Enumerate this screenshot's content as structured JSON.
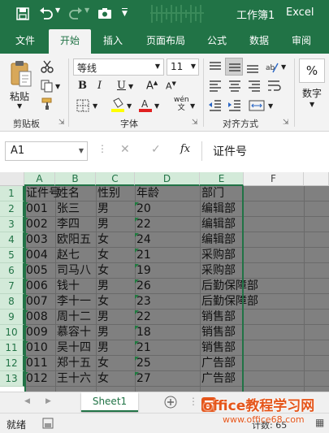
{
  "title_bar": {
    "doc_name": "工作簿1",
    "app_name": "Excel"
  },
  "tabs": [
    {
      "label": "文件",
      "active": false
    },
    {
      "label": "开始",
      "active": true
    },
    {
      "label": "插入",
      "active": false
    },
    {
      "label": "页面布局",
      "active": false
    },
    {
      "label": "公式",
      "active": false
    },
    {
      "label": "数据",
      "active": false
    },
    {
      "label": "审阅",
      "active": false
    }
  ],
  "ribbon": {
    "paste_label": "粘贴",
    "clipboard_group": "剪贴板",
    "font_name": "等线",
    "font_size": "11",
    "font_group": "字体",
    "bold": "B",
    "italic": "I",
    "underline": "U",
    "wen": "wén",
    "alignment_group": "对齐方式",
    "number_label": "数字",
    "percent": "%"
  },
  "formula_bar": {
    "name_box": "A1",
    "fx": "fx",
    "content": "证件号"
  },
  "columns": [
    "A",
    "B",
    "C",
    "D",
    "E",
    "F"
  ],
  "rows": [
    {
      "num": "1",
      "cells": [
        "证件号",
        "姓名",
        "性别",
        "年龄",
        "部门"
      ]
    },
    {
      "num": "2",
      "cells": [
        "001",
        "张三",
        "男",
        "20",
        "编辑部"
      ]
    },
    {
      "num": "3",
      "cells": [
        "002",
        "李四",
        "男",
        "22",
        "编辑部"
      ]
    },
    {
      "num": "4",
      "cells": [
        "003",
        "欧阳五",
        "女",
        "24",
        "编辑部"
      ]
    },
    {
      "num": "5",
      "cells": [
        "004",
        "赵七",
        "女",
        "21",
        "采购部"
      ]
    },
    {
      "num": "6",
      "cells": [
        "005",
        "司马八",
        "女",
        "19",
        "采购部"
      ]
    },
    {
      "num": "7",
      "cells": [
        "006",
        "钱十",
        "男",
        "26",
        "后勤保障部"
      ]
    },
    {
      "num": "8",
      "cells": [
        "007",
        "李十一",
        "女",
        "23",
        "后勤保障部"
      ]
    },
    {
      "num": "9",
      "cells": [
        "008",
        "周十二",
        "男",
        "22",
        "销售部"
      ]
    },
    {
      "num": "10",
      "cells": [
        "009",
        "慕容十",
        "男",
        "18",
        "销售部"
      ]
    },
    {
      "num": "11",
      "cells": [
        "010",
        "吴十四",
        "男",
        "21",
        "销售部"
      ]
    },
    {
      "num": "12",
      "cells": [
        "011",
        "郑十五",
        "女",
        "25",
        "广告部"
      ]
    },
    {
      "num": "13",
      "cells": [
        "012",
        "王十六",
        "女",
        "27",
        "广告部"
      ]
    }
  ],
  "sheet_tab": "Sheet1",
  "status": {
    "ready": "就绪",
    "count": "计数: 65"
  },
  "watermark": {
    "title": "office教程学习网",
    "url": "www.office68.com"
  },
  "colors": {
    "excel_green": "#217346",
    "selection_gray": "#808080"
  },
  "icons": [
    "save-icon",
    "undo-icon",
    "redo-icon",
    "camera-icon",
    "customize-icon",
    "ribbon-display-icon",
    "paste-icon",
    "cut-icon",
    "copy-icon",
    "format-painter-icon",
    "font-color-icon",
    "fill-color-icon",
    "align-icon",
    "wrap-icon",
    "fx-icon",
    "add-sheet-icon"
  ]
}
